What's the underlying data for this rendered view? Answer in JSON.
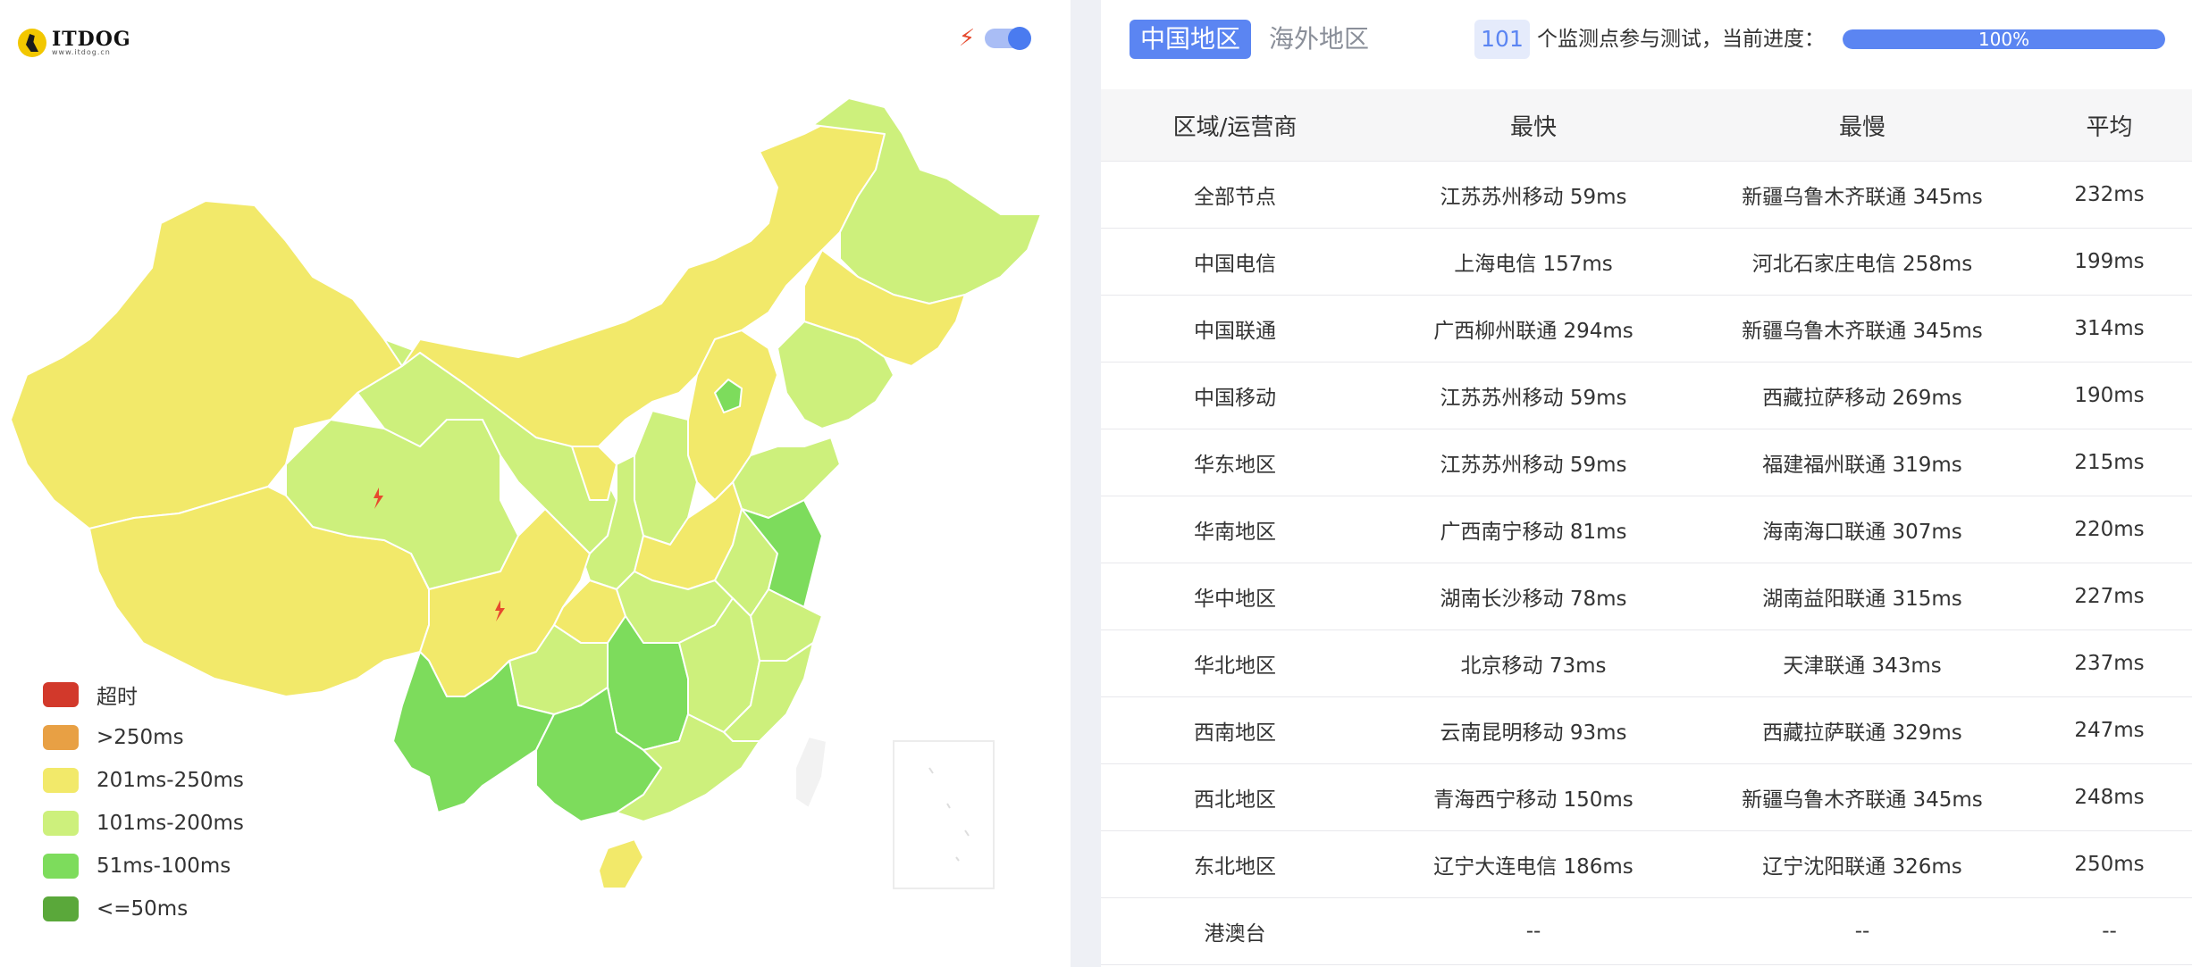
{
  "brand": {
    "name": "ITDOG",
    "url": "www.itdog.cn"
  },
  "map": {
    "toggle_on": true,
    "colors": {
      "timeout": "#d2392b",
      "gt250": "#e8a044",
      "c201_250": "#f2e96a",
      "c101_200": "#cdf07c",
      "c51_100": "#7ddc5c",
      "le50": "#5aa83a",
      "hk_area": "#f2f2f2"
    },
    "legend": [
      {
        "label": "超时",
        "color": "#d2392b"
      },
      {
        "label": ">250ms",
        "color": "#e8a044"
      },
      {
        "label": "201ms-250ms",
        "color": "#f2e96a"
      },
      {
        "label": "101ms-200ms",
        "color": "#cdf07c"
      },
      {
        "label": "51ms-100ms",
        "color": "#7ddc5c"
      },
      {
        "label": "<=50ms",
        "color": "#5aa83a"
      }
    ]
  },
  "header": {
    "tab_cn": "中国地区",
    "tab_overseas": "海外地区",
    "node_count": "101",
    "progress_label": "个监测点参与测试，当前进度：",
    "progress_text": "100%",
    "progress_value": 1.0
  },
  "table": {
    "columns": [
      "区域/运营商",
      "最快",
      "最慢",
      "平均"
    ],
    "rows": [
      [
        "全部节点",
        "江苏苏州移动 59ms",
        "新疆乌鲁木齐联通 345ms",
        "232ms"
      ],
      [
        "中国电信",
        "上海电信 157ms",
        "河北石家庄电信 258ms",
        "199ms"
      ],
      [
        "中国联通",
        "广西柳州联通 294ms",
        "新疆乌鲁木齐联通 345ms",
        "314ms"
      ],
      [
        "中国移动",
        "江苏苏州移动 59ms",
        "西藏拉萨移动 269ms",
        "190ms"
      ],
      [
        "华东地区",
        "江苏苏州移动 59ms",
        "福建福州联通 319ms",
        "215ms"
      ],
      [
        "华南地区",
        "广西南宁移动 81ms",
        "海南海口联通 307ms",
        "220ms"
      ],
      [
        "华中地区",
        "湖南长沙移动 78ms",
        "湖南益阳联通 315ms",
        "227ms"
      ],
      [
        "华北地区",
        "北京移动 73ms",
        "天津联通 343ms",
        "237ms"
      ],
      [
        "西南地区",
        "云南昆明移动 93ms",
        "西藏拉萨联通 329ms",
        "247ms"
      ],
      [
        "西北地区",
        "青海西宁移动 150ms",
        "新疆乌鲁木齐联通 345ms",
        "248ms"
      ],
      [
        "东北地区",
        "辽宁大连电信 186ms",
        "辽宁沈阳联通 326ms",
        "250ms"
      ],
      [
        "港澳台",
        "--",
        "--",
        "--"
      ]
    ]
  }
}
